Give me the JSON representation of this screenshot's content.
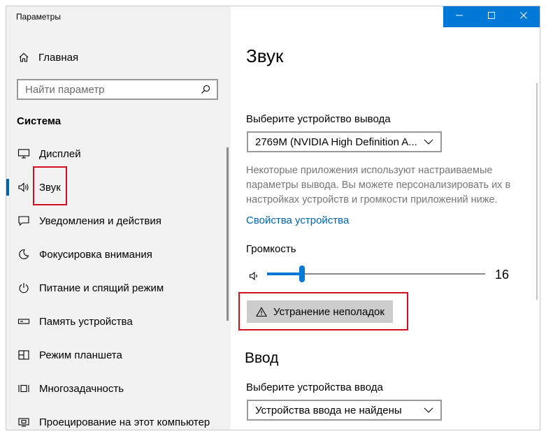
{
  "window": {
    "title": "Параметры"
  },
  "titlebar": {
    "minimize_icon": "minimize-icon",
    "maximize_icon": "maximize-icon",
    "close_icon": "close-icon",
    "accent": "#0078d7"
  },
  "sidebar": {
    "home_label": "Главная",
    "search_placeholder": "Найти параметр",
    "section_title": "Система",
    "items": [
      {
        "label": "Дисплей",
        "icon": "monitor-icon"
      },
      {
        "label": "Звук",
        "icon": "speaker-icon",
        "active": true
      },
      {
        "label": "Уведомления и действия",
        "icon": "notification-icon"
      },
      {
        "label": "Фокусировка внимания",
        "icon": "moon-icon"
      },
      {
        "label": "Питание и спящий режим",
        "icon": "power-icon"
      },
      {
        "label": "Память устройства",
        "icon": "storage-icon"
      },
      {
        "label": "Режим планшета",
        "icon": "tablet-icon"
      },
      {
        "label": "Многозадачность",
        "icon": "multitask-icon"
      },
      {
        "label": "Проецирование на этот компьютер",
        "icon": "projection-icon"
      }
    ]
  },
  "main": {
    "title": "Звук",
    "output_label": "Выберите устройство вывода",
    "output_device": "2769M (NVIDIA High Definition A...",
    "output_description": "Некоторые приложения используют настраиваемые параметры вывода. Вы можете персонализировать их в настройках устройств и громкости приложений ниже.",
    "device_properties_link": "Свойства устройства",
    "volume_label": "Громкость",
    "volume_value": "16",
    "volume_fraction": 0.16,
    "troubleshoot_label": "Устранение неполадок",
    "input_heading": "Ввод",
    "input_label": "Выберите устройства ввода",
    "input_device": "Устройства ввода не найдены"
  },
  "colors": {
    "accent": "#0078d7",
    "link": "#0063b1",
    "highlight": "#d10f1e"
  }
}
